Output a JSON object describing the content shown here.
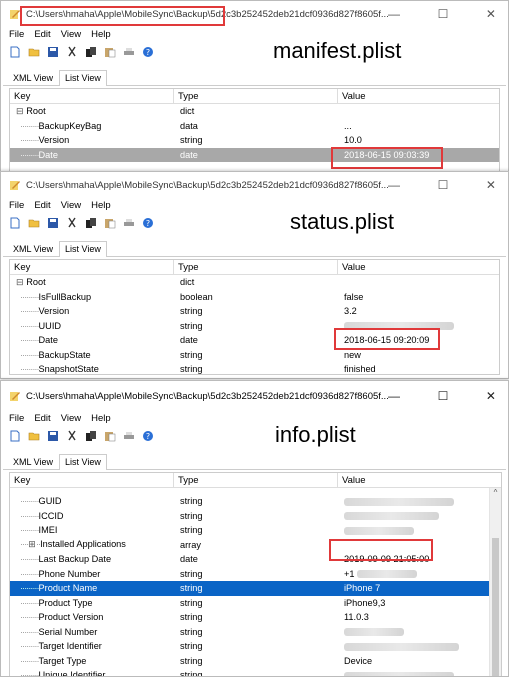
{
  "window1": {
    "path": "C:\\Users\\hmaha\\Apple\\MobileSync\\Backup\\5d2c3b252452deb21dcf0936d827f8605f...",
    "menu": [
      "File",
      "Edit",
      "View",
      "Help"
    ],
    "caption": "manifest.plist",
    "tabs": [
      "XML View",
      "List View"
    ],
    "headers": [
      "Key",
      "Type",
      "Value"
    ],
    "rows": [
      {
        "key": "Root",
        "type": "dict",
        "value": ""
      },
      {
        "key": "BackupKeyBag",
        "type": "data",
        "value": "..."
      },
      {
        "key": "Version",
        "type": "string",
        "value": "10.0"
      },
      {
        "key": "Date",
        "type": "date",
        "value": "2018-06-15 09:03:39"
      }
    ]
  },
  "window2": {
    "path": "C:\\Users\\hmaha\\Apple\\MobileSync\\Backup\\5d2c3b252452deb21dcf0936d827f8605f...",
    "menu": [
      "File",
      "Edit",
      "View",
      "Help"
    ],
    "caption": "status.plist",
    "tabs": [
      "XML View",
      "List View"
    ],
    "headers": [
      "Key",
      "Type",
      "Value"
    ],
    "rows": [
      {
        "key": "Root",
        "type": "dict",
        "value": ""
      },
      {
        "key": "IsFullBackup",
        "type": "boolean",
        "value": "false"
      },
      {
        "key": "Version",
        "type": "string",
        "value": "3.2"
      },
      {
        "key": "UUID",
        "type": "string",
        "value": ""
      },
      {
        "key": "Date",
        "type": "date",
        "value": "2018-06-15 09:20:09"
      },
      {
        "key": "BackupState",
        "type": "string",
        "value": "new"
      },
      {
        "key": "SnapshotState",
        "type": "string",
        "value": "finished"
      }
    ]
  },
  "window3": {
    "path": "C:\\Users\\hmaha\\Apple\\MobileSync\\Backup\\5d2c3b252452deb21dcf0936d827f8605f...",
    "menu": [
      "File",
      "Edit",
      "View",
      "Help"
    ],
    "caption": "info.plist",
    "tabs": [
      "XML View",
      "List View"
    ],
    "headers": [
      "Key",
      "Type",
      "Value"
    ],
    "rows": [
      {
        "key": "GUID",
        "type": "string",
        "value": ""
      },
      {
        "key": "ICCID",
        "type": "string",
        "value": ""
      },
      {
        "key": "IMEI",
        "type": "string",
        "value": ""
      },
      {
        "key": "Installed Applications",
        "type": "array",
        "value": ""
      },
      {
        "key": "Last Backup Date",
        "type": "date",
        "value": "2019-09-09 21:05:00"
      },
      {
        "key": "Phone Number",
        "type": "string",
        "value": "+1"
      },
      {
        "key": "Product Name",
        "type": "string",
        "value": "iPhone 7"
      },
      {
        "key": "Product Type",
        "type": "string",
        "value": "iPhone9,3"
      },
      {
        "key": "Product Version",
        "type": "string",
        "value": "11.0.3"
      },
      {
        "key": "Serial Number",
        "type": "string",
        "value": ""
      },
      {
        "key": "Target Identifier",
        "type": "string",
        "value": ""
      },
      {
        "key": "Target Type",
        "type": "string",
        "value": "Device"
      },
      {
        "key": "Unique Identifier",
        "type": "string",
        "value": ""
      }
    ]
  },
  "colors": {
    "highlight": "#e0393a",
    "selection": "#0a64c6"
  }
}
